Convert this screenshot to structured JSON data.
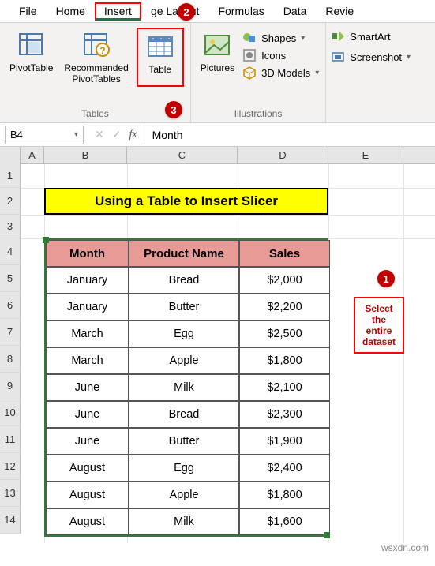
{
  "ribbon": {
    "tabs": [
      "File",
      "Home",
      "Insert",
      "Page Layout",
      "Formulas",
      "Data",
      "Review"
    ],
    "active_tab": "Insert",
    "groups": {
      "tables": {
        "label": "Tables",
        "pivot": "PivotTable",
        "recommended": "Recommended\nPivotTables",
        "table": "Table"
      },
      "illustrations": {
        "label": "Illustrations",
        "pictures": "Pictures",
        "shapes": "Shapes",
        "icons": "Icons",
        "models": "3D Models"
      },
      "side": {
        "smartart": "SmartArt",
        "screenshot": "Screenshot"
      }
    }
  },
  "namebox": {
    "value": "B4"
  },
  "formula_bar": {
    "value": "Month"
  },
  "columns": [
    "A",
    "B",
    "C",
    "D",
    "E"
  ],
  "row_numbers": [
    "1",
    "2",
    "3",
    "4",
    "5",
    "6",
    "7",
    "8",
    "9",
    "10",
    "11",
    "12",
    "13",
    "14"
  ],
  "title": "Using a Table to Insert Slicer",
  "table": {
    "headers": [
      "Month",
      "Product Name",
      "Sales"
    ],
    "rows": [
      [
        "January",
        "Bread",
        "$2,000"
      ],
      [
        "January",
        "Butter",
        "$2,200"
      ],
      [
        "March",
        "Egg",
        "$2,500"
      ],
      [
        "March",
        "Apple",
        "$1,800"
      ],
      [
        "June",
        "Milk",
        "$2,100"
      ],
      [
        "June",
        "Bread",
        "$2,300"
      ],
      [
        "June",
        "Butter",
        "$1,900"
      ],
      [
        "August",
        "Egg",
        "$2,400"
      ],
      [
        "August",
        "Apple",
        "$1,800"
      ],
      [
        "August",
        "Milk",
        "$1,600"
      ]
    ]
  },
  "badges": {
    "b1": "1",
    "b2": "2",
    "b3": "3"
  },
  "annotation": "Select the entire dataset",
  "watermark": "wsxdn.com"
}
